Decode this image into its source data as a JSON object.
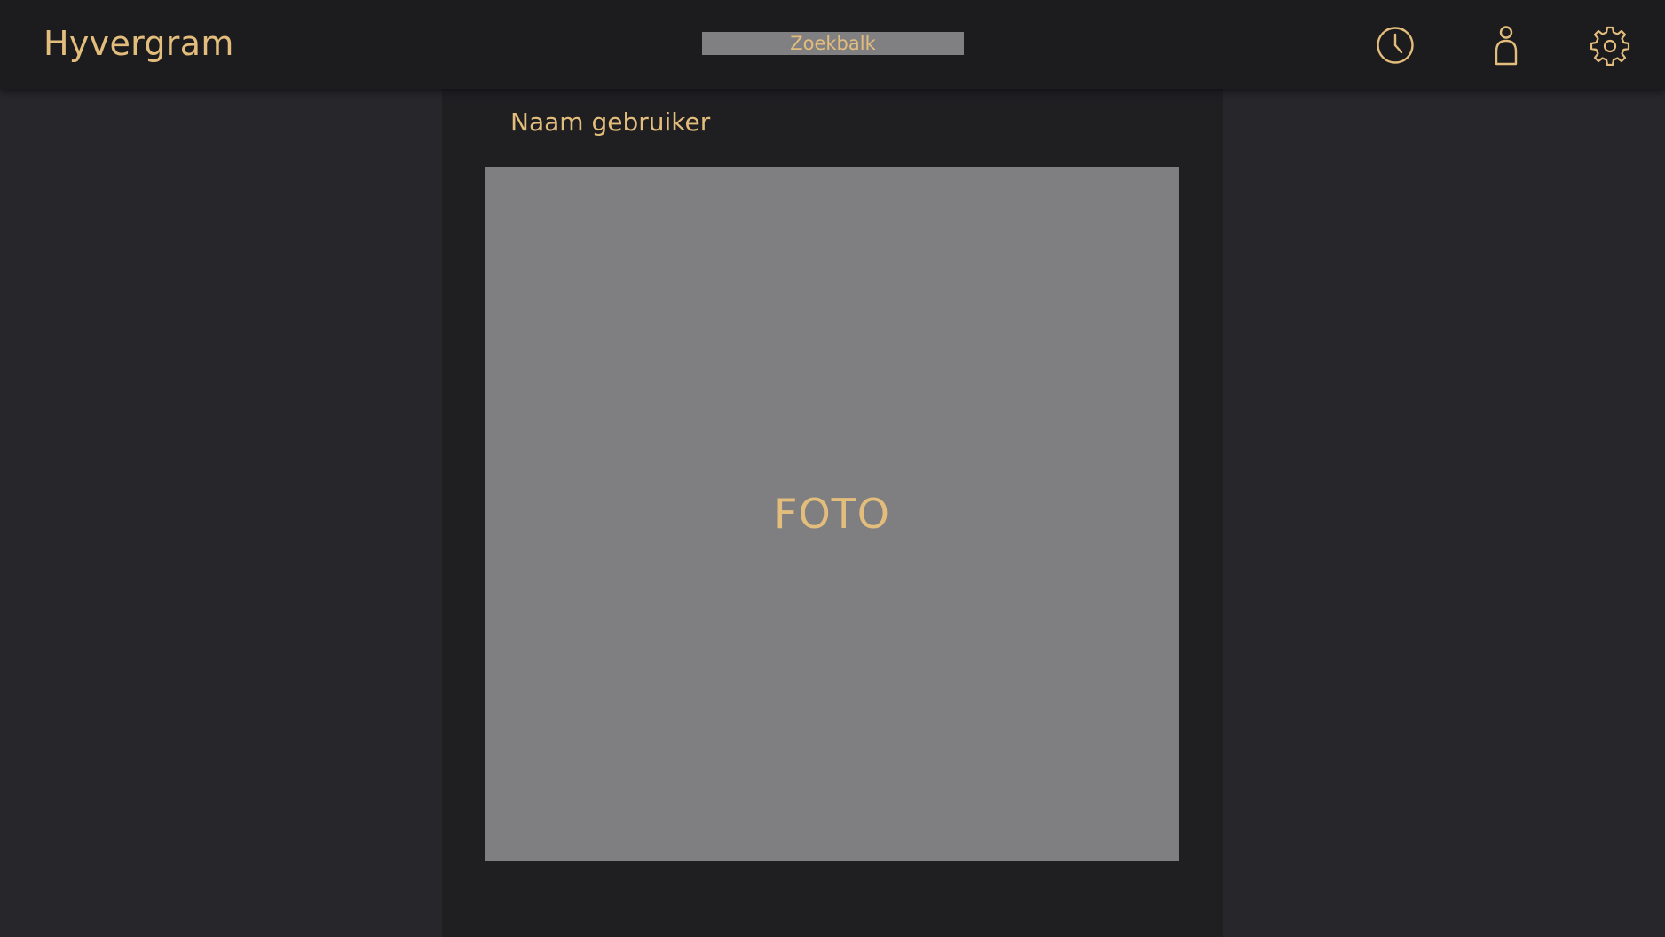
{
  "app": {
    "title": "Hyvergram"
  },
  "search": {
    "placeholder": "Zoekbalk"
  },
  "toolbar": {
    "icons": [
      "clock-icon",
      "user-icon",
      "gear-icon"
    ]
  },
  "post": {
    "username": "Naam gebruiker",
    "photo_label": "FOTO"
  },
  "colors": {
    "accent": "#e3bd7c",
    "topbar": "#1c1c1f",
    "background": "#26262b",
    "feed": "#1f1f22",
    "photo": "#7f7f81"
  }
}
